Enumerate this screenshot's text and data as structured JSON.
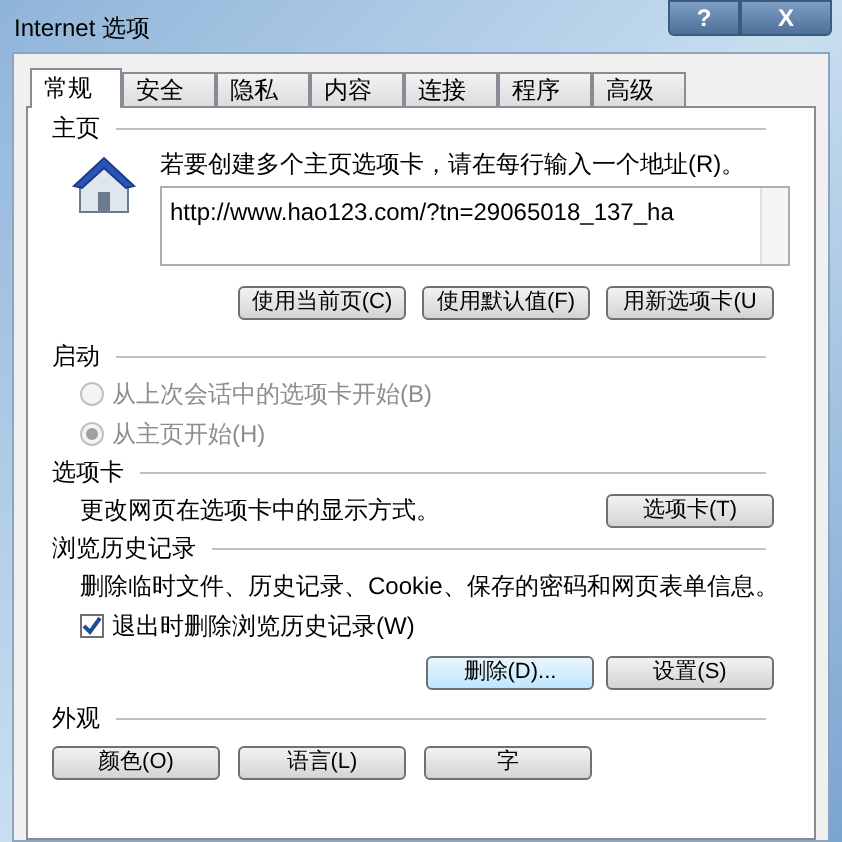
{
  "window": {
    "title": "Internet 选项",
    "help_button": "?",
    "close_button": "X"
  },
  "tabs": [
    {
      "label": "常规",
      "selected": true
    },
    {
      "label": "安全",
      "selected": false
    },
    {
      "label": "隐私",
      "selected": false
    },
    {
      "label": "内容",
      "selected": false
    },
    {
      "label": "连接",
      "selected": false
    },
    {
      "label": "程序",
      "selected": false
    },
    {
      "label": "高级",
      "selected": false
    }
  ],
  "home_page": {
    "heading": "主页",
    "instruction": "若要创建多个主页选项卡，请在每行输入一个地址(R)。",
    "address": "http://www.hao123.com/?tn=29065018_137_ha",
    "buttons": [
      "使用当前页(C)",
      "使用默认值(F)",
      "用新选项卡(U"
    ]
  },
  "startup": {
    "heading": "启动",
    "options": [
      {
        "label": "从上次会话中的选项卡开始(B)",
        "selected": false,
        "disabled": true
      },
      {
        "label": "从主页开始(H)",
        "selected": true,
        "disabled": true
      }
    ]
  },
  "tabs_section": {
    "heading": "选项卡",
    "description": "更改网页在选项卡中的显示方式。",
    "button": "选项卡(T)"
  },
  "history": {
    "heading": "浏览历史记录",
    "description": "删除临时文件、历史记录、Cookie、保存的密码和网页表单信息。",
    "checkbox": {
      "label": "退出时删除浏览历史记录(W)",
      "checked": true
    },
    "buttons": [
      {
        "label": "删除(D)...",
        "focused": true
      },
      {
        "label": "设置(S)",
        "focused": false
      }
    ]
  },
  "appearance": {
    "heading": "外观",
    "buttons": [
      "颜色(O)",
      "语言(L)",
      "字"
    ]
  }
}
